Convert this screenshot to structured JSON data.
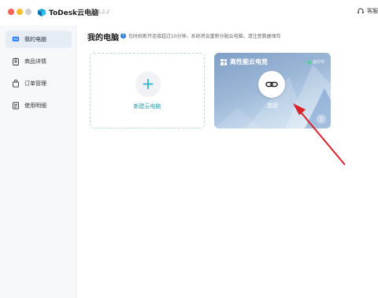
{
  "app": {
    "name": "ToDesk云电脑",
    "version": "V1.0.2.2",
    "service_label": "客服"
  },
  "sidebar": {
    "items": [
      {
        "label": "我的电脑",
        "icon": "monitor-icon",
        "active": true
      },
      {
        "label": "商品详情",
        "icon": "clipboard-icon",
        "active": false
      },
      {
        "label": "订单管理",
        "icon": "bag-icon",
        "active": false
      },
      {
        "label": "使用明细",
        "icon": "document-list-icon",
        "active": false
      }
    ]
  },
  "main": {
    "title": "我的电脑",
    "notice": "包时机断开连接超过10分钟，系统将会重新分配云电脑，请注意数据保存",
    "new_card": {
      "label": "新建云电脑"
    },
    "pc_card": {
      "title": "高性能云电竞",
      "status": "运行中",
      "connect_label": "连接"
    }
  },
  "colors": {
    "accent": "#2bb3c0",
    "status_green": "#47d18c",
    "annotation_red": "#d9222a",
    "info_blue": "#2f7ff4"
  }
}
